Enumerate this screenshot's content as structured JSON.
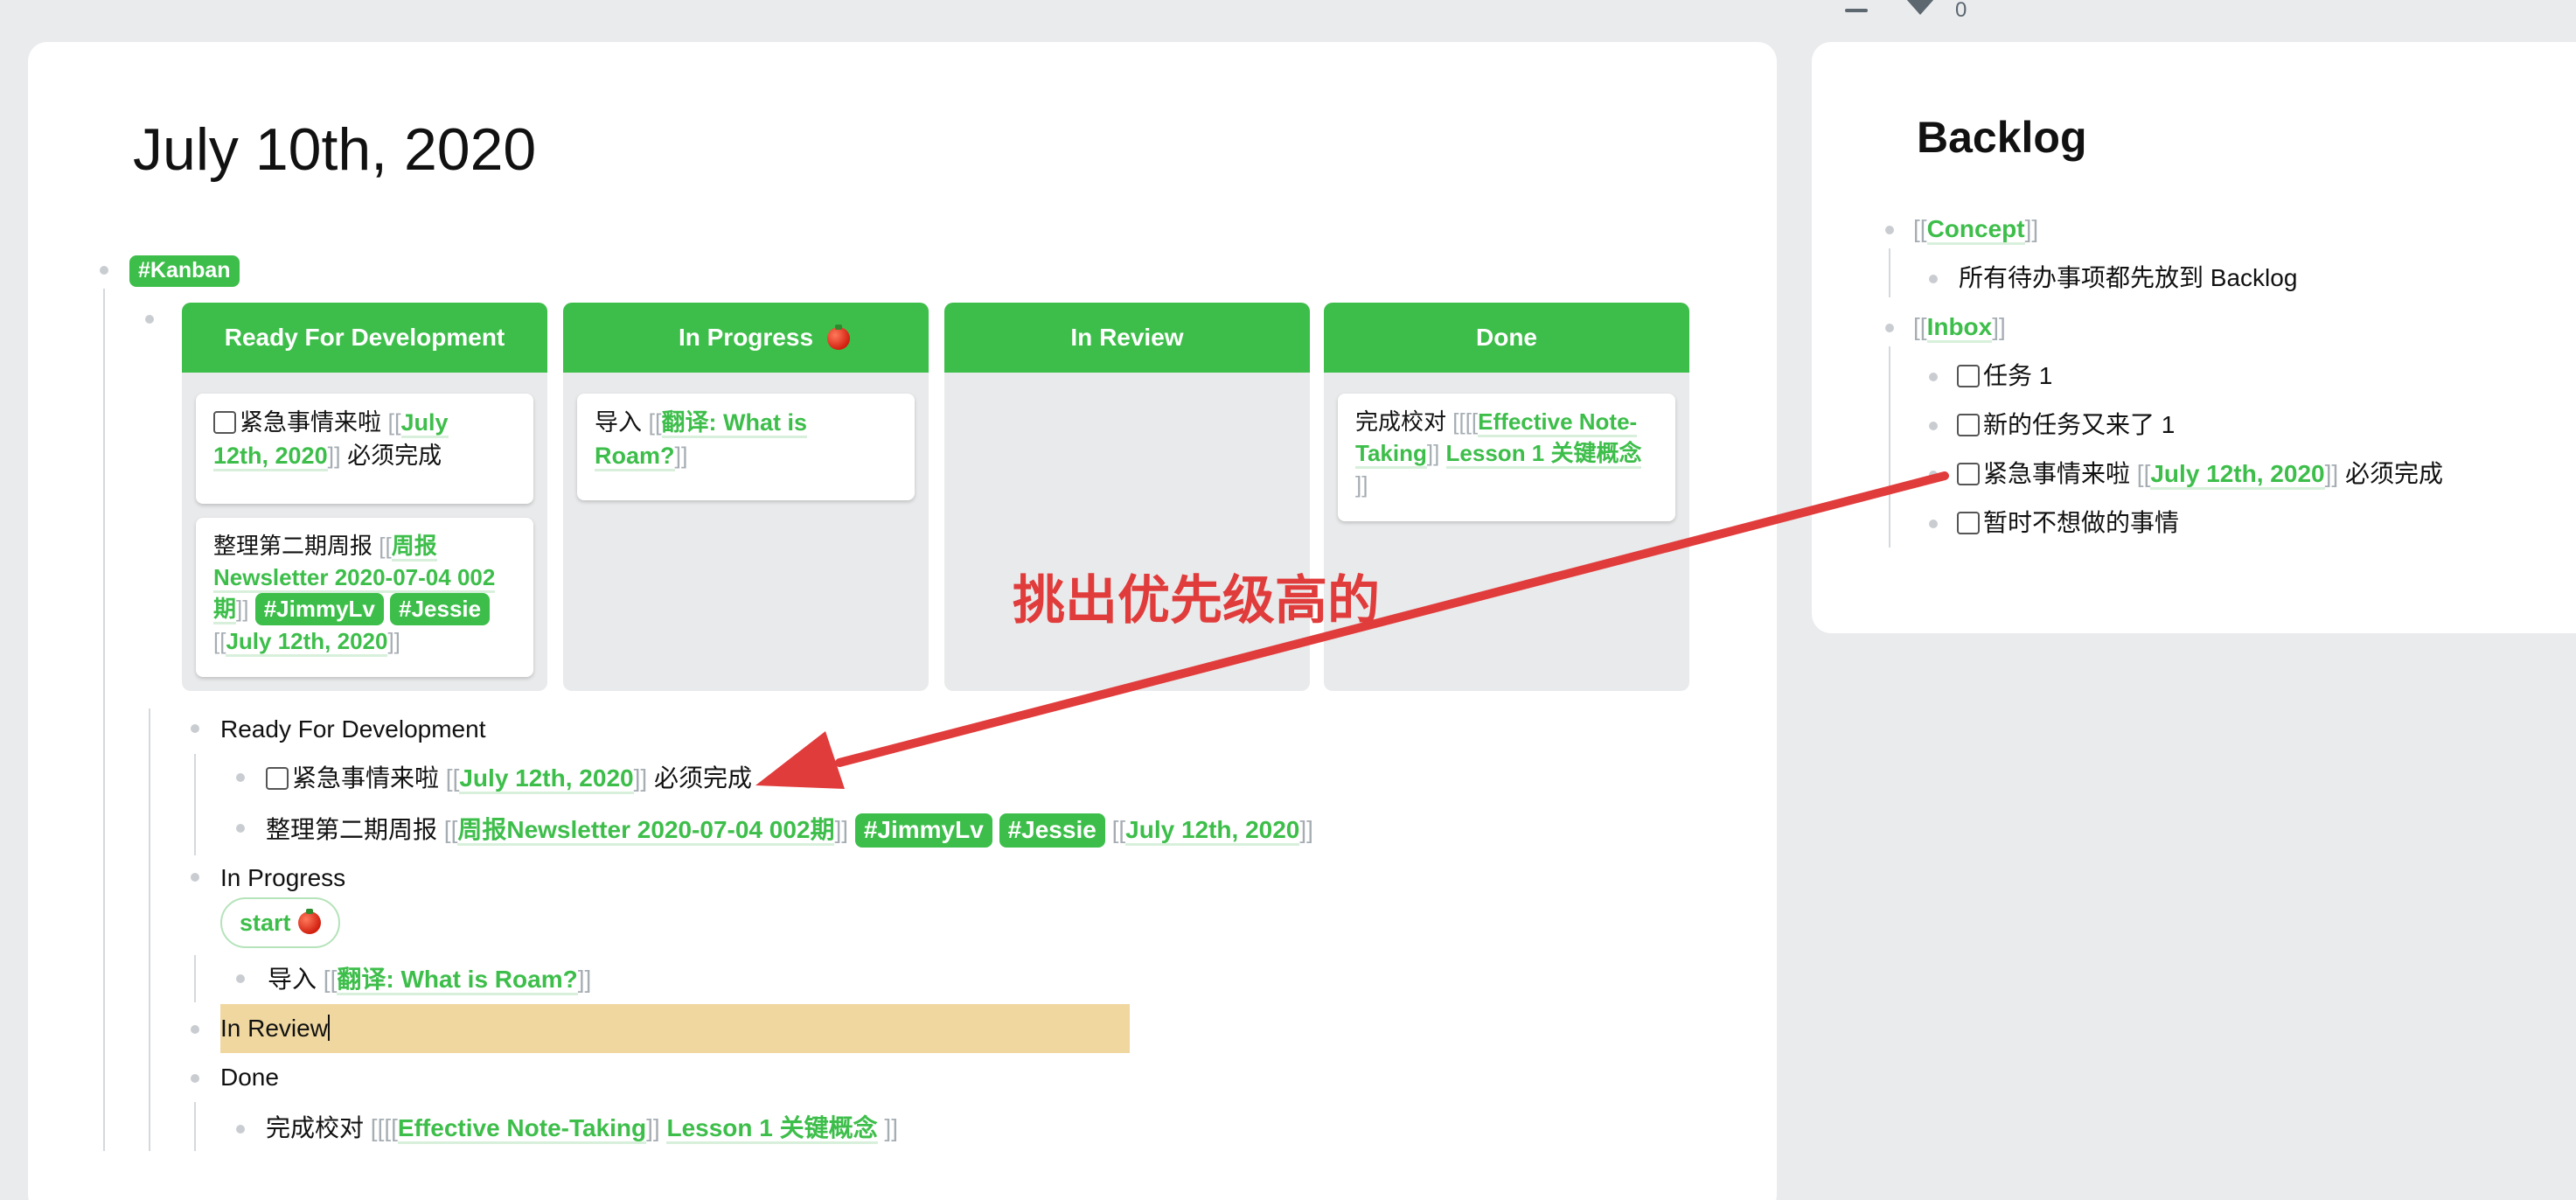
{
  "topbar": {
    "filter_count": "0"
  },
  "page": {
    "title": "July 10th, 2020"
  },
  "kanban": {
    "tag": "#Kanban",
    "columns": [
      {
        "title": "Ready For Development"
      },
      {
        "title": "In Progress"
      },
      {
        "title": "In Review"
      },
      {
        "title": "Done"
      }
    ],
    "cards": {
      "rfd1_text": "紧急事情来啦",
      "rfd1_ref_a": "July",
      "rfd1_ref_b": "12th, 2020",
      "rfd1_suffix": "必须完成",
      "rfd2_text": "整理第二期周报",
      "rfd2_ref_a": "周报",
      "rfd2_ref_b": "Newsletter 2020-07-04 002",
      "rfd2_ref_c": "期",
      "rfd2_tag1": "#JimmyLv",
      "rfd2_tag2": "#Jessie",
      "rfd2_ref_date": "July 12th, 2020",
      "ip1_text": "导入",
      "ip1_ref_a": "翻译: What is",
      "ip1_ref_b": "Roam?",
      "done1_text": "完成校对",
      "done1_ref_a": "Effective Note-",
      "done1_ref_b": "Taking",
      "done1_ref_c": "Lesson 1 关键概念"
    }
  },
  "outline": {
    "rfd_label": "Ready For Development",
    "rfd_item1_text": "紧急事情来啦",
    "rfd_item1_ref": "July 12th, 2020",
    "rfd_item1_suffix": "必须完成",
    "rfd_item2_text": "整理第二期周报",
    "rfd_item2_ref": "周报Newsletter 2020-07-04 002期",
    "rfd_item2_tag1": "#JimmyLv",
    "rfd_item2_tag2": "#Jessie",
    "rfd_item2_date": "July 12th, 2020",
    "ip_label": "In Progress",
    "start_label": "start",
    "ip_item1_text": "导入",
    "ip_item1_ref": "翻译: What is Roam?",
    "ir_label": "In Review",
    "done_label": "Done",
    "done_item1_text": "完成校对",
    "done_item1_ref_a": "Effective Note-Taking",
    "done_item1_ref_b": "Lesson 1 关键概念"
  },
  "annotation": {
    "text": "挑出优先级高的"
  },
  "backlog": {
    "title": "Backlog",
    "concept_ref": "Concept",
    "concept_child": "所有待办事项都先放到 Backlog",
    "inbox_ref": "Inbox",
    "task1": "任务 1",
    "task2": "新的任务又来了 1",
    "task3_text": "紧急事情来啦",
    "task3_ref": "July 12th, 2020",
    "task3_suffix": "必须完成",
    "task4": "暂时不想做的事情"
  },
  "colors": {
    "accent": "#3dbe4a",
    "annotation": "#e13c3c",
    "highlight": "#f0d7a0"
  }
}
